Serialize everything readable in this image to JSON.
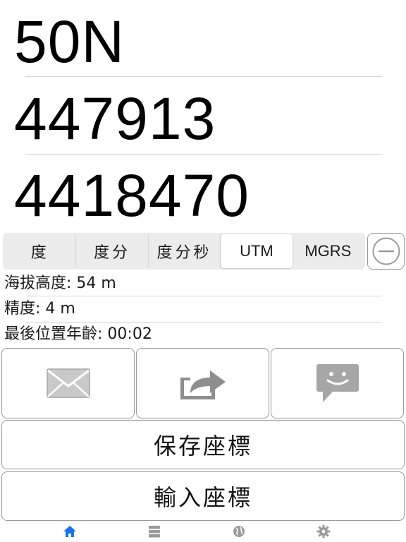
{
  "coordinates": {
    "zone": "50N",
    "easting": "447913",
    "northing": "4418470"
  },
  "format_selector": {
    "options": [
      "度",
      "度分",
      "度分秒",
      "UTM",
      "MGRS"
    ],
    "selected": "UTM"
  },
  "info": {
    "altitude_label": "海拔高度:",
    "altitude_value": "54 m",
    "accuracy_label": "精度:",
    "accuracy_value": "4 m",
    "age_label": "最後位置年齡:",
    "age_value": "00:02"
  },
  "actions": {
    "icons": [
      "mail-icon",
      "share-icon",
      "message-icon"
    ],
    "save_label": "保存座標",
    "input_label": "輸入座標"
  },
  "tabbar": {
    "tabs": [
      "home-icon",
      "list-icon",
      "globe-icon",
      "gear-icon"
    ],
    "selected": "home-icon"
  },
  "colors": {
    "accent": "#1a73e8",
    "tab_inactive": "#9a9a9a",
    "icon_gray": "#a6a6a6"
  }
}
